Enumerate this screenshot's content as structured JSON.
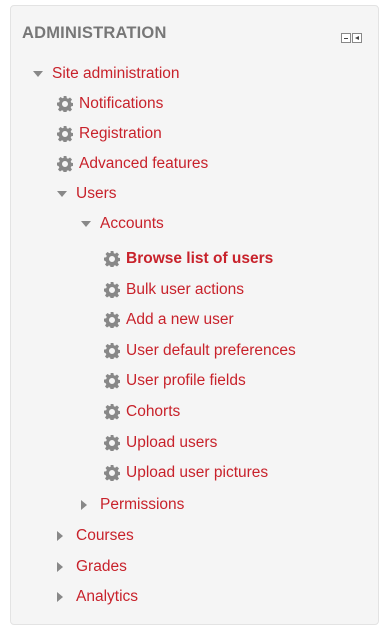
{
  "header": {
    "title": "ADMINISTRATION"
  },
  "controls": {
    "minimize_icon": "minimize-icon",
    "dock_icon": "dock-icon"
  },
  "tree": {
    "site_admin": "Site administration",
    "notifications": "Notifications",
    "registration": "Registration",
    "advanced_features": "Advanced features",
    "users": "Users",
    "accounts": "Accounts",
    "accounts_items": [
      "Browse list of users",
      "Bulk user actions",
      "Add a new user",
      "User default preferences",
      "User profile fields",
      "Cohorts",
      "Upload users",
      "Upload user pictures"
    ],
    "permissions": "Permissions",
    "courses": "Courses",
    "grades": "Grades",
    "analytics": "Analytics"
  },
  "colors": {
    "link": "#c8222b",
    "header": "#777777",
    "icon": "#888888",
    "panel_bg": "#f5f5f5"
  }
}
